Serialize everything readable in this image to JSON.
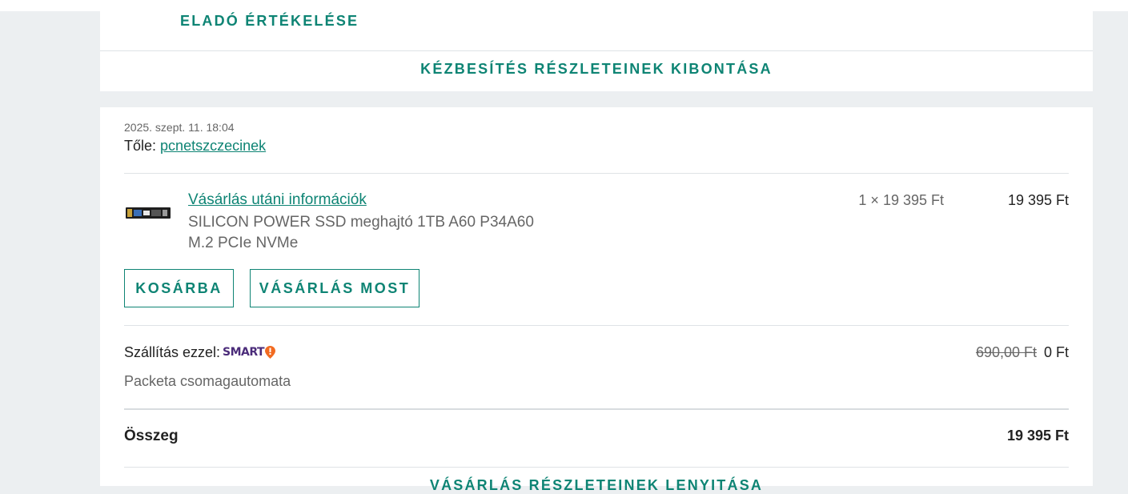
{
  "seller_card": {
    "seller_rating_label": "ELADÓ ÉRTÉKELÉSE",
    "expand_delivery_label": "KÉZBESÍTÉS RÉSZLETEINEK KIBONTÁSA"
  },
  "order": {
    "date": "2025. szept. 11. 18:04",
    "from_label": "Tőle:",
    "seller_name": "pcnetszczecinek",
    "item": {
      "link_label": "Vásárlás utáni információk",
      "title": "SILICON POWER SSD meghajtó 1TB A60 P34A60 M.2 PCIe NVMe",
      "unit_price": "1 × 19 395 Ft",
      "line_total": "19 395 Ft"
    },
    "buttons": {
      "add_to_cart": "KOSÁRBA",
      "buy_now": "VÁSÁRLÁS MOST"
    },
    "shipping": {
      "label": "Szállítás ezzel:",
      "brand_logo": "SMART",
      "method": "Packeta csomagautomata",
      "old_price": "690,00 Ft",
      "price": "0 Ft"
    },
    "total": {
      "label": "Összeg",
      "value": "19 395 Ft"
    },
    "collapse_details_label": "VÁSÁRLÁS RÉSZLETEINEK LENYITÁSA"
  },
  "colors": {
    "accent": "#0e8474",
    "background": "#eceff1",
    "smart_brand": "#4b2c7a",
    "smart_pin": "#f26b21"
  },
  "icons": {
    "product": "ssd-thumbnail-icon",
    "shipping_brand": "smart-pin-icon"
  }
}
